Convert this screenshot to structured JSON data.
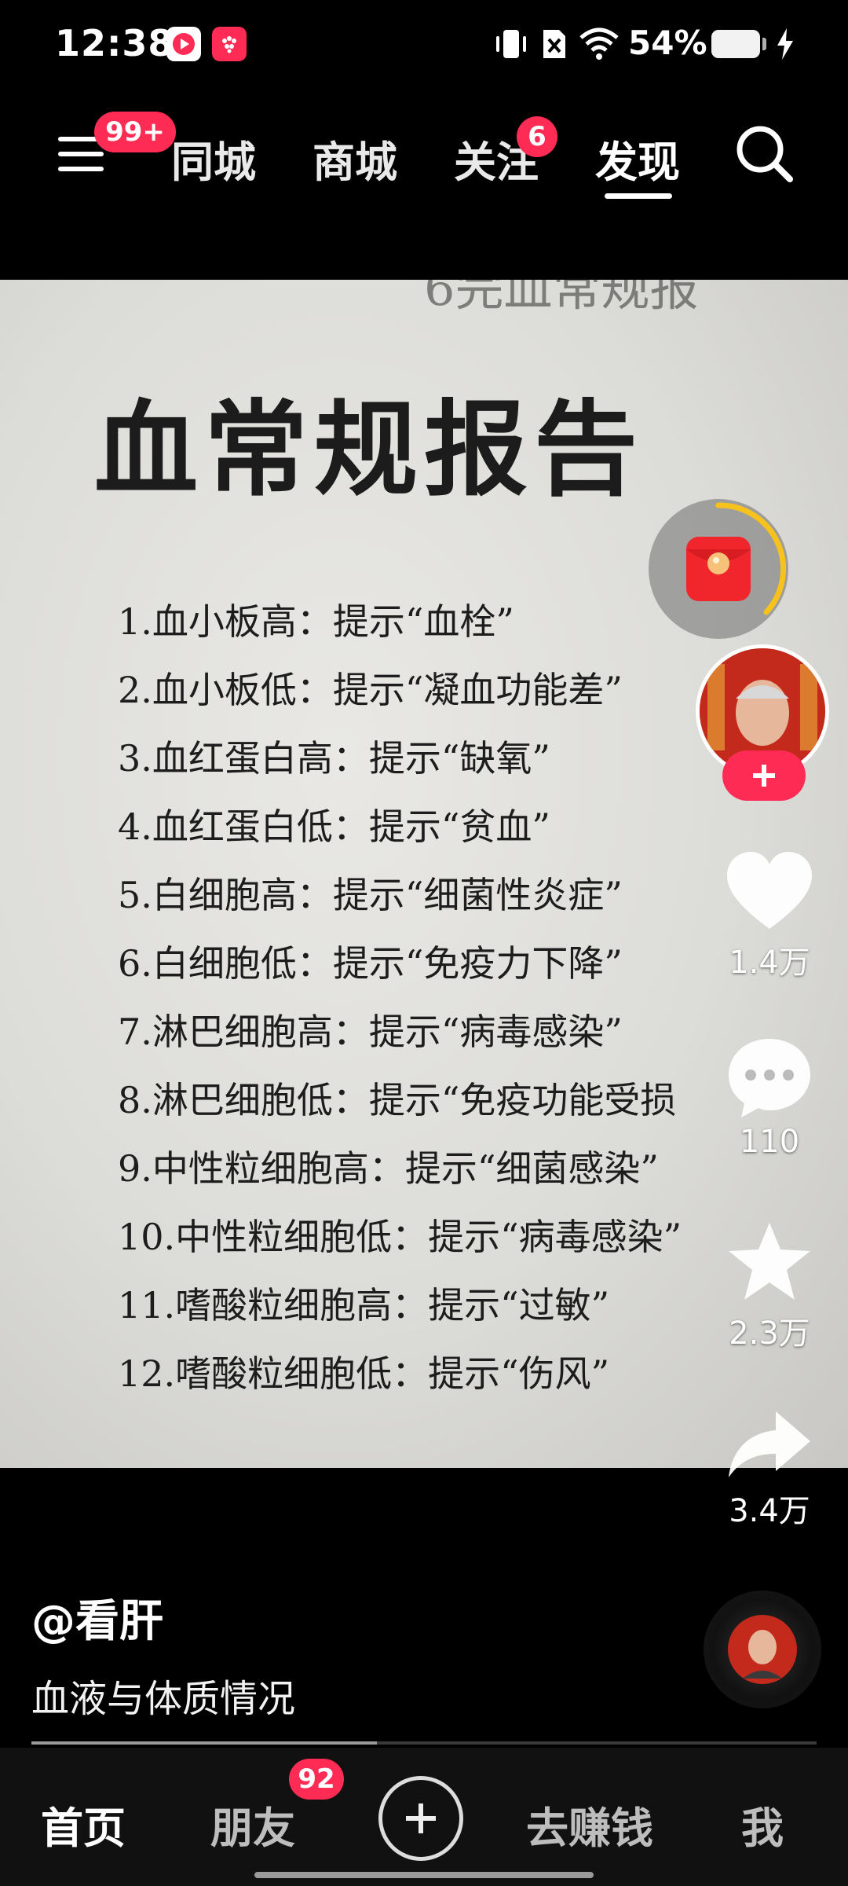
{
  "status_bar": {
    "time": "12:38",
    "battery": "54%",
    "icons": [
      "video-app-icon",
      "gift-app-icon",
      "vibrate-icon",
      "no-sim-icon",
      "wifi-icon",
      "battery-icon",
      "charging-icon"
    ]
  },
  "top_nav": {
    "menu_badge": "99+",
    "tabs": [
      {
        "label": "同城"
      },
      {
        "label": "商城"
      },
      {
        "label": "关注",
        "badge": "6"
      },
      {
        "label": "发现",
        "active": true
      }
    ]
  },
  "video": {
    "top_cut_text": "6完血常规报",
    "title": "血常规报告",
    "lines": [
      "1.血小板高：提示“血栓”",
      "2.血小板低：提示“凝血功能差”",
      "3.血红蛋白高：提示“缺氧”",
      "4.血红蛋白低：提示“贫血”",
      "5.白细胞高：提示“细菌性炎症”",
      "6.白细胞低：提示“免疫力下降”",
      "7.淋巴细胞高：提示“病毒感染”",
      "8.淋巴细胞低：提示“免疫功能受损",
      "9.中性粒细胞高：提示“细菌感染”",
      "10.中性粒细胞低：提示“病毒感染”",
      "11.嗜酸粒细胞高：提示“过敏”",
      "12.嗜酸粒细胞低：提示“伤风”"
    ]
  },
  "rail": {
    "likes": "1.4万",
    "comments": "110",
    "favorites": "2.3万",
    "shares": "3.4万"
  },
  "caption": {
    "author": "@看肝",
    "description": "血液与体质情况"
  },
  "bottom_nav": {
    "home": "首页",
    "friends": "朋友",
    "friends_badge": "92",
    "earn": "去赚钱",
    "me": "我"
  },
  "colors": {
    "accent": "#fe2c55",
    "background": "#000000"
  }
}
